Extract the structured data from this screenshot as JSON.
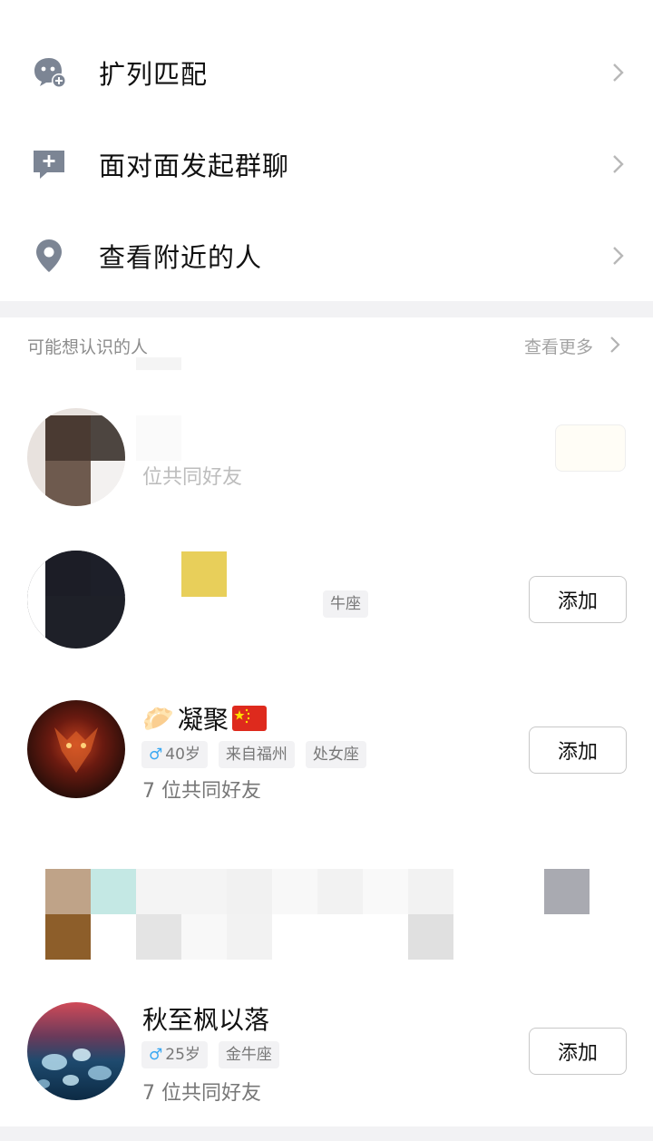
{
  "menu": [
    {
      "label": "扩列匹配",
      "icon": "face-plus-icon"
    },
    {
      "label": "面对面发起群聊",
      "icon": "chat-plus-icon"
    },
    {
      "label": "查看附近的人",
      "icon": "location-pin-icon"
    }
  ],
  "suggest": {
    "title": "可能想认识的人",
    "more": "查看更多"
  },
  "people": [
    {
      "mutual": "位共同好友"
    },
    {
      "tag_constellation": "牛座",
      "add": "添加"
    },
    {
      "name": "凝聚",
      "gender_age": "40岁",
      "origin": "来自福州",
      "constellation": "处女座",
      "mutual": "7 位共同好友",
      "add": "添加"
    },
    {
      "name": "秋至枫以落",
      "gender_age": "25岁",
      "constellation": "金牛座",
      "mutual": "7 位共同好友",
      "add": "添加"
    }
  ],
  "colors": {
    "accent_male": "#3aa8f2",
    "icon_gray": "#7c8594",
    "divider": "#f2f2f4"
  }
}
